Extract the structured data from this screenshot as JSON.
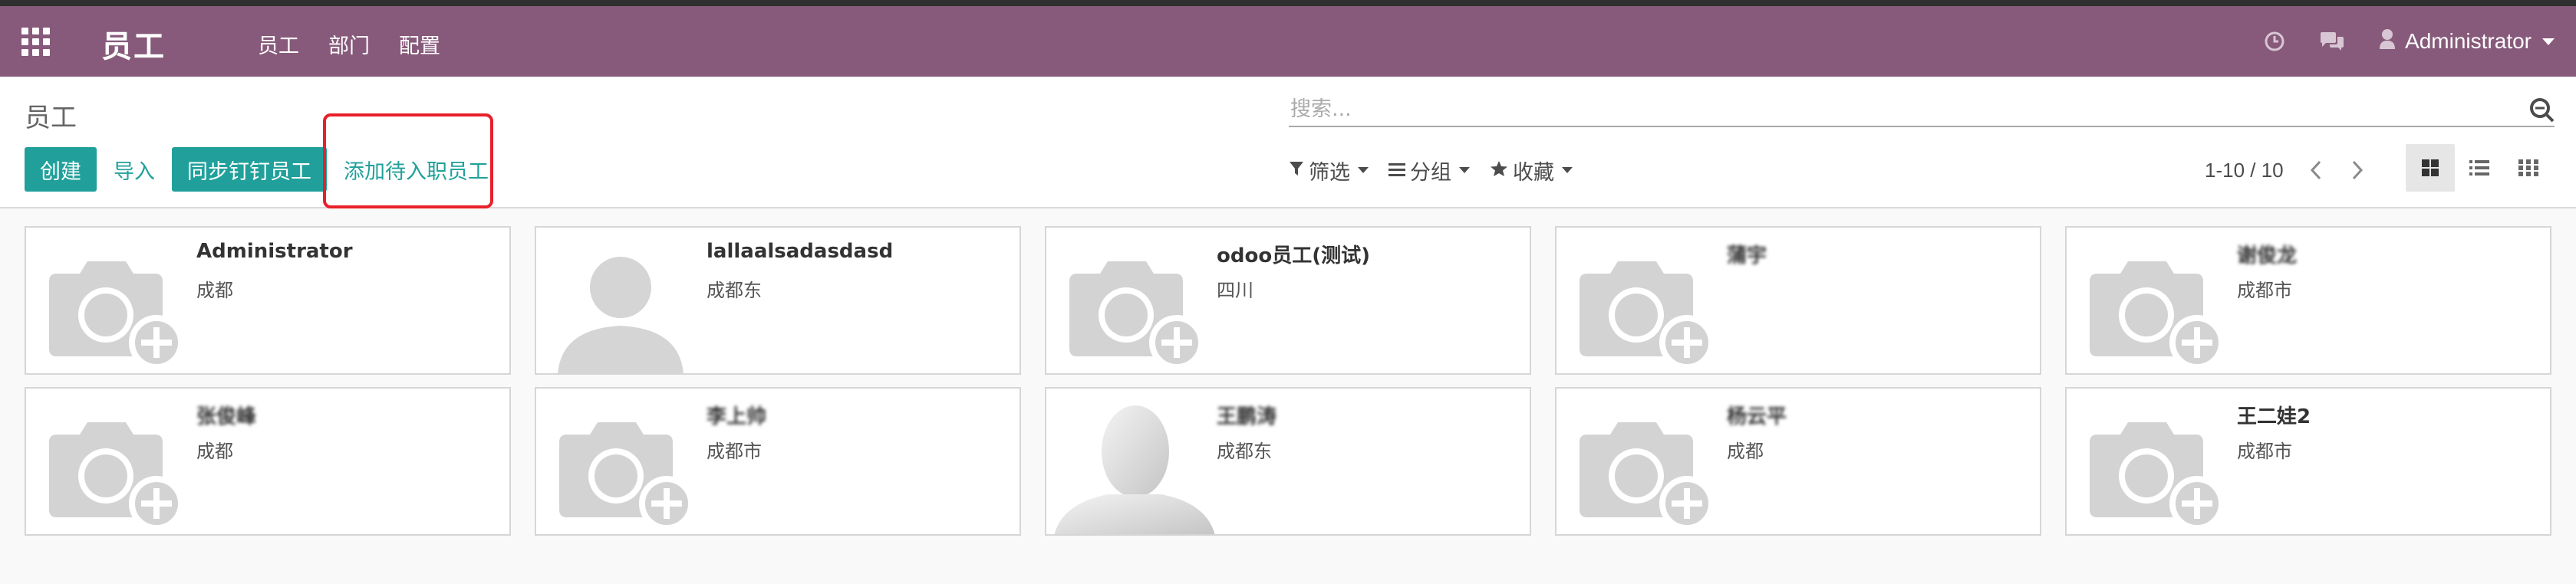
{
  "navbar": {
    "brand": "员工",
    "menu": [
      "员工",
      "部门",
      "配置"
    ],
    "user": "Administrator",
    "bg_color": "#875a7b"
  },
  "breadcrumb": "员工",
  "search": {
    "placeholder": "搜索..."
  },
  "buttons": {
    "create": "创建",
    "import": "导入",
    "sync": "同步钉钉员工",
    "add_pending": "添加待入职员工"
  },
  "search_options": {
    "filter": "筛选",
    "group": "分组",
    "favorites": "收藏"
  },
  "pager": {
    "value": "1-10 / 10"
  },
  "accent_color": "#21a09b",
  "highlight_color": "#e8202a",
  "employees": [
    {
      "name": "Administrator",
      "location": "成都",
      "avatar": "camera-placeholder-icon"
    },
    {
      "name": "lallaalsadasdasd",
      "location": "成都东",
      "avatar": "person-silhouette-icon"
    },
    {
      "name": "odoo员工(测试)",
      "location": "四川",
      "avatar": "camera-placeholder-icon"
    },
    {
      "name": "蒲宇",
      "location": "",
      "avatar": "camera-placeholder-icon",
      "obscured": true
    },
    {
      "name": "谢俊龙",
      "location": "成都市",
      "avatar": "camera-placeholder-icon",
      "obscured": true
    },
    {
      "name": "张俊峰",
      "location": "成都",
      "avatar": "camera-placeholder-icon",
      "obscured": true
    },
    {
      "name": "李上帅",
      "location": "成都市",
      "avatar": "camera-placeholder-icon",
      "obscured": true
    },
    {
      "name": "王鹏涛",
      "location": "成都东",
      "avatar": "mannequin-avatar-icon",
      "obscured": true
    },
    {
      "name": "杨云平",
      "location": "成都",
      "avatar": "camera-placeholder-icon",
      "obscured": true
    },
    {
      "name": "王二娃2",
      "location": "成都市",
      "avatar": "camera-placeholder-icon"
    }
  ]
}
